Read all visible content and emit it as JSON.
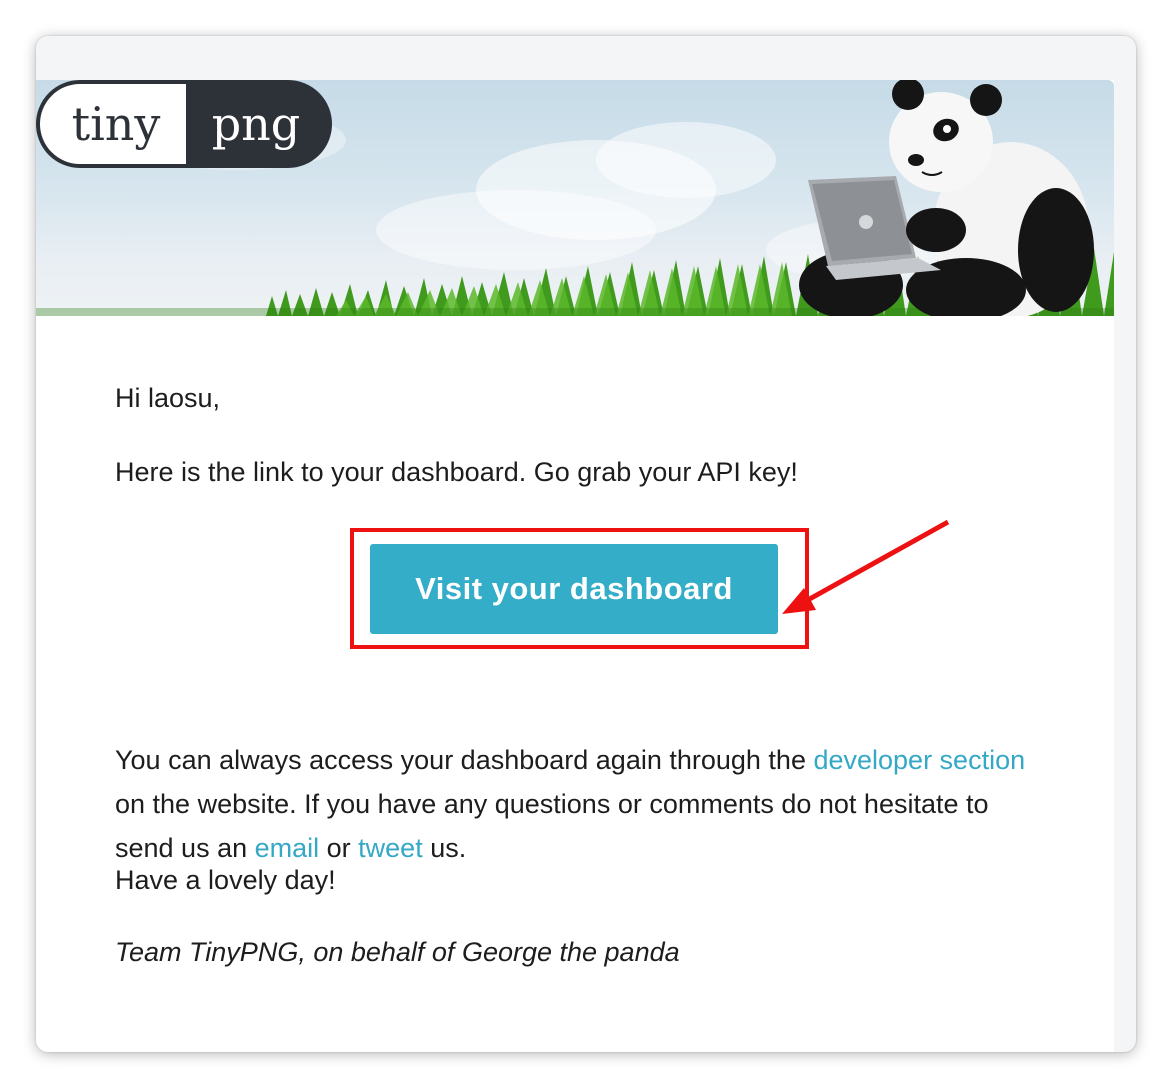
{
  "brand": {
    "logo_left": "tiny",
    "logo_right": "png",
    "logo_dark": "#2d3138"
  },
  "banner": {
    "icon": "panda-with-laptop-illustration"
  },
  "message": {
    "greeting": "Hi laosu,",
    "intro": "Here is the link to your dashboard. Go grab your API key!",
    "cta_label": "Visit your dashboard",
    "para_part1": "You can always access your dashboard again through the ",
    "developer_link": "developer section",
    "para_part2": " on the website. If you have any questions or comments do not hesitate to send us an ",
    "email_link": "email",
    "para_part3": " or ",
    "tweet_link": "tweet",
    "para_part4": " us.",
    "closing": "Have a lovely day!",
    "signature": "Team TinyPNG, on behalf of George the panda"
  },
  "colors": {
    "accent": "#34adc8",
    "link": "#35a8c6",
    "annotation": "#ee1111",
    "text": "#1d1d1d"
  }
}
